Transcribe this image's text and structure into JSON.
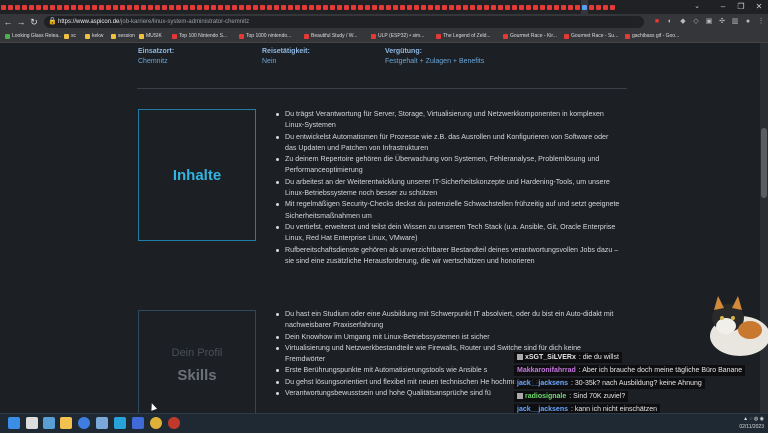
{
  "browser": {
    "url_host": "https://www.aspicon.de",
    "url_path": "/job-karriere/linux-system-administrator-chemnitz",
    "tab_count": 88
  },
  "bookmarks": [
    {
      "label": "Looking Glass Relea...",
      "color": "#4caf50"
    },
    {
      "label": "sc",
      "color": "#f0c040"
    },
    {
      "label": "kekw",
      "color": "#f0c040"
    },
    {
      "label": "session",
      "color": "#f0c040"
    },
    {
      "label": "MUSIK",
      "color": "#f0c040"
    },
    {
      "label": "Top 100 Nintendo S...",
      "color": "#e53935"
    },
    {
      "label": "Top 1000 nintendo...",
      "color": "#e53935"
    },
    {
      "label": "Beautiful Study / W...",
      "color": "#e53935"
    },
    {
      "label": "ULP (ESP32) • sim...",
      "color": "#e53935"
    },
    {
      "label": "The Legend of Zeld...",
      "color": "#e53935"
    },
    {
      "label": "Gourmet Race - Kir...",
      "color": "#e53935"
    },
    {
      "label": "Gourmet Race - Su...",
      "color": "#e53935"
    },
    {
      "label": "gachibass gif - Goo...",
      "color": "#e53935"
    }
  ],
  "job": {
    "einsatzort_label": "Einsatzort:",
    "einsatzort_value": "Chemnitz",
    "reise_label": "Reisetätigkeit:",
    "reise_value": "Nein",
    "verguetung_label": "Vergütung:",
    "verguetung_value": "Festgehalt + Zulagen + Benefits"
  },
  "inhalte": {
    "title": "Inhalte",
    "items": [
      "Du trägst Verantwortung für Server, Storage, Virtualisierung und Netzwerkkomponenten in komplexen Linux-Systemen",
      "Du entwickelst Automatismen für Prozesse wie z.B. das Ausrollen und Konfigurieren von Software oder das Updaten und Patchen von Infrastrukturen",
      "Zu deinem Repertoire gehören die Überwachung von Systemen, Fehleranalyse, Problemlösung und Performanceoptimierung",
      "Du arbeitest an der Weiterentwicklung unserer IT-Sicherheitskonzepte und Hardening-Tools, um unsere Linux-Betriebssysteme noch besser zu schützen",
      "Mit regelmäßigen Security-Checks deckst du potenzielle Schwachstellen frühzeitig auf und setzt geeignete Sicherheitsmaßnahmen um",
      "Du vertiefst, erweiterst und teilst dein Wissen zu unserem Tech Stack (u.a. Ansible, Git, Oracle Enterprise Linux, Red Hat Enterprise Linux, VMware)",
      "Rufbereitschaftsdienste gehören als unverzichtbarer Bestandteil deines verantwortungsvollen Jobs dazu – sie sind eine zusätzliche Herausforderung, die wir wertschätzen und honorieren"
    ]
  },
  "skills": {
    "subtitle": "Dein Profil",
    "title": "Skills",
    "items": [
      "Du hast ein Studium oder eine Ausbildung mit Schwerpunkt IT absolviert, oder du bist ein Auto-didakt mit nachweisbarer Praxiserfahrung",
      "Dein Knowhow im Umgang mit Linux-Betriebssystemen ist sicher",
      "Virtualisierung und Netzwerkbestandteile wie Firewalls, Router und Switche sind für dich keine Fremdwörter",
      "Erste Berührungspunkte mit Automatisierungstools wie Ansible s",
      "Du gehst lösungsorientiert und flexibel mit neuen technischen He hochmotiviert zu lernen",
      "Verantwortungsbewusstsein und hohe Qualitätsansprüche sind fü"
    ]
  },
  "chat": [
    {
      "user": "xSGT_SiLVERx",
      "color": "#e6e6e6",
      "text": "die du willst",
      "badge": true
    },
    {
      "user": "Makkaronifahrrad",
      "color": "#c678dd",
      "text": "Aber ich brauche doch meine tägliche Büro Banane",
      "badge": false
    },
    {
      "user": "jack__jacksens",
      "color": "#6aa6ff",
      "text": "30-35k? nach Ausbildung? keine Ahnung",
      "badge": false
    },
    {
      "user": "radiosignale",
      "color": "#6fdc6f",
      "text": "Sind 70K zuviel?",
      "badge": true
    },
    {
      "user": "jack__jacksens",
      "color": "#6aa6ff",
      "text": "kann ich nicht einschätzen",
      "badge": false
    }
  ],
  "taskbar": {
    "date": "02/11/2023"
  }
}
